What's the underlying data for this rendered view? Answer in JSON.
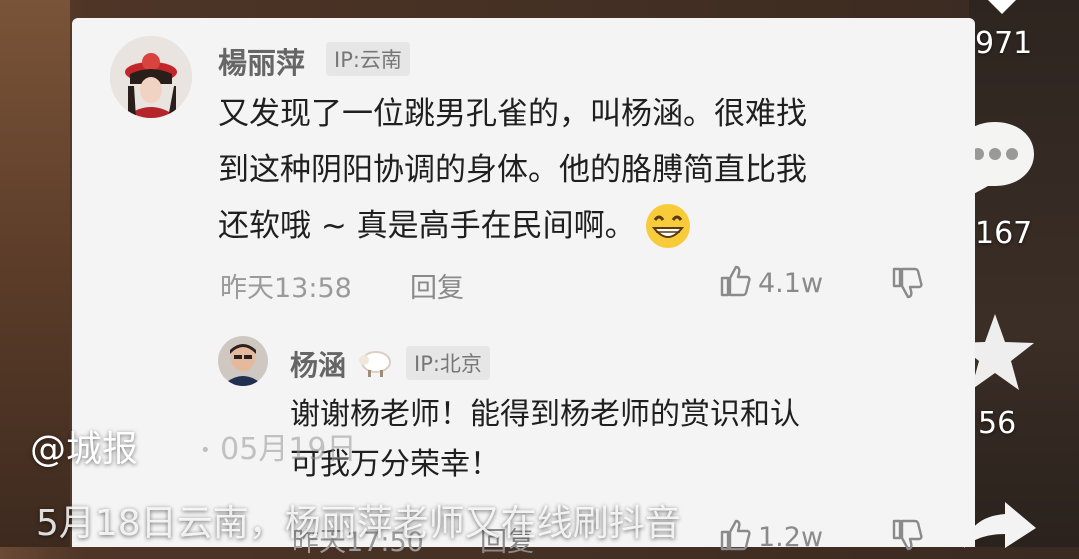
{
  "main_comment": {
    "username": "楊丽萍",
    "ip": "IP:云南",
    "lines": [
      "又发现了一位跳男孔雀的，叫杨涵。很难找",
      "到这种阴阳协调的身体。他的胳膊简直比我",
      "还软哦 ~ 真是高手在民间啊。"
    ],
    "time": "昨天13:58",
    "reply_label": "回复",
    "likes": "4.1w"
  },
  "reply_comment": {
    "username": "杨涵",
    "ip": "IP:北京",
    "lines": [
      "谢谢杨老师！能得到杨老师的赏识和认",
      "可我万分荣幸！"
    ],
    "time_partial": "昨天17:50",
    "reply_label": "回复",
    "likes": "1.2w"
  },
  "ghost_date": "05月19日",
  "right_rail": {
    "count_1": "971",
    "count_2": "167",
    "count_3": "56"
  },
  "overlay": {
    "watermark": "@城报",
    "caption": "5月18日云南，杨丽萍老师又在线刷抖音"
  }
}
